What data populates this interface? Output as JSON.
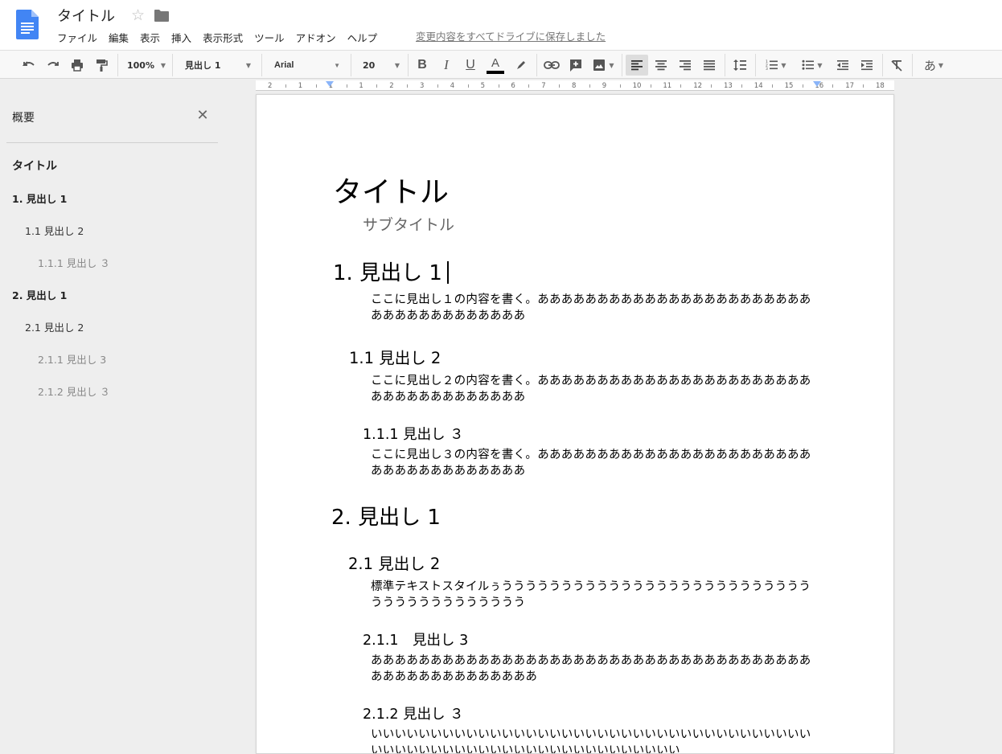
{
  "header": {
    "doc_title": "タイトル",
    "menu": [
      "ファイル",
      "編集",
      "表示",
      "挿入",
      "表示形式",
      "ツール",
      "アドオン",
      "ヘルプ"
    ],
    "save_status": "変更内容をすべてドライブに保存しました"
  },
  "toolbar": {
    "zoom": "100%",
    "style": "見出し 1",
    "font": "Arial",
    "font_size": "20",
    "input_tools_label": "あ"
  },
  "ruler": {
    "labels": [
      "2",
      "1",
      "1",
      "1",
      "2",
      "3",
      "4",
      "5",
      "6",
      "7",
      "8",
      "9",
      "10",
      "11",
      "12",
      "13",
      "14",
      "15",
      "16",
      "17",
      "18"
    ]
  },
  "outline": {
    "title": "概要",
    "items": [
      {
        "label": "タイトル",
        "level": 0
      },
      {
        "label": "1. 見出し 1",
        "level": 1
      },
      {
        "label": "1.1 見出し 2",
        "level": 2
      },
      {
        "label": "1.1.1 見出し ３",
        "level": 3
      },
      {
        "label": "2. 見出し 1",
        "level": 1
      },
      {
        "label": "2.1 見出し 2",
        "level": 2
      },
      {
        "label": "2.1.1 見出し 3",
        "level": 3
      },
      {
        "label": "2.1.2 見出し ３",
        "level": 3
      }
    ]
  },
  "document": {
    "title": "タイトル",
    "subtitle": "サブタイトル",
    "h1_1": "1. 見出し 1",
    "p1": "ここに見出し１の内容を書く。ああああああああああああああああああああああああああああああああああああ",
    "h2_1": "1.1 見出し 2",
    "p2": "ここに見出し２の内容を書く。ああああああああああああああああああああああああああああああああああああ",
    "h3_1": "1.1.1 見出し ３",
    "p3": "ここに見出し３の内容を書く。ああああああああああああああああああああああああああああああああああああ",
    "h1_2": "2. 見出し 1",
    "h2_2": "2.1 見出し 2",
    "p4": "標準テキストスタイルぅううううううううううううううううううううううううううううううううううううううう",
    "h3_2": "2.1.1　見出し 3",
    "p5": "あああああああああああああああああああああああああああああああああああああああああああああああああああ",
    "h3_3": "2.1.2  見出し ３",
    "p6": "いいいいいいいいいいいいいいいいいいいいいいいいいいいいいいいいいいいいいいいいいいいいいいいいいいいいいいいいいいいいいいい"
  },
  "colors": {
    "docs_blue": "#4285f4",
    "page_bg": "#ffffff",
    "app_bg": "#eeeeee",
    "text_color_underline": "#000000"
  }
}
